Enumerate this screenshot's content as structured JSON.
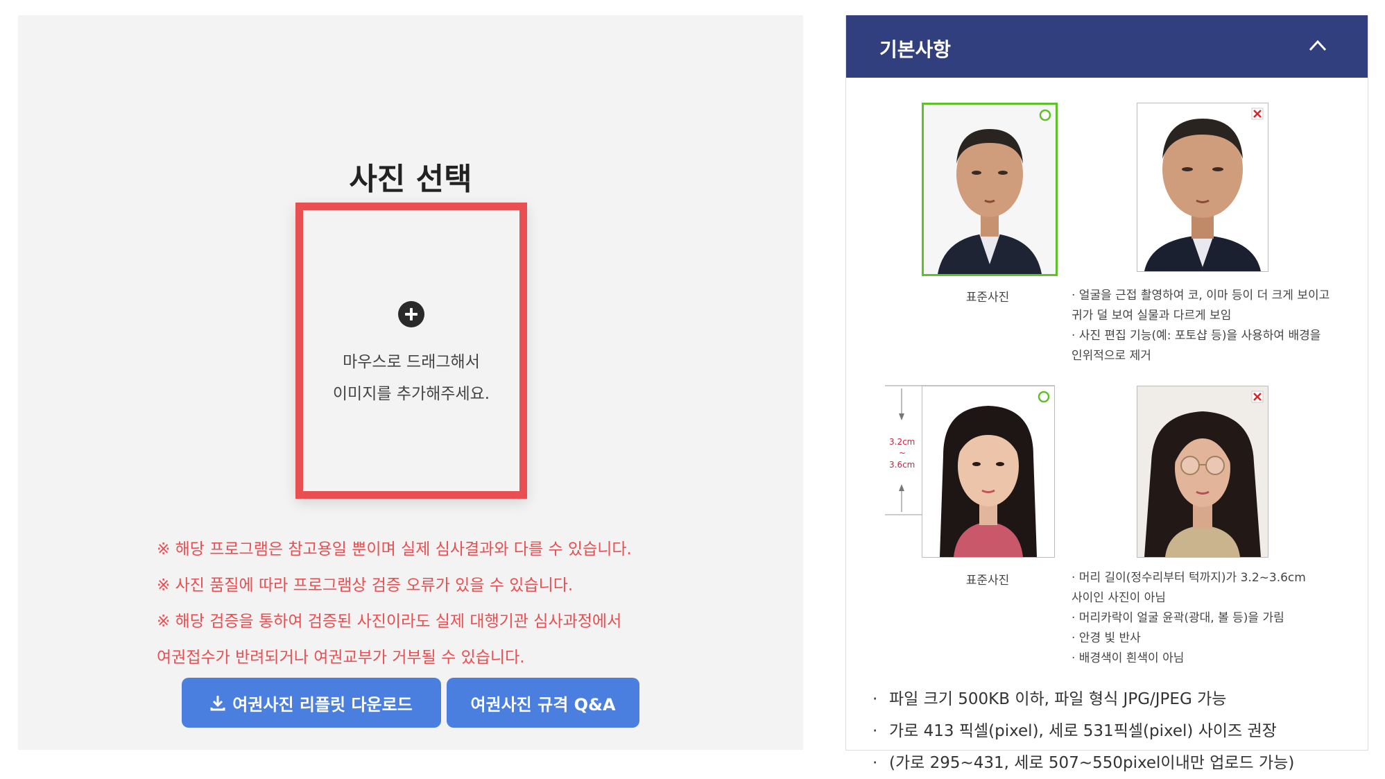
{
  "left": {
    "title": "사진 선택",
    "dropzone": {
      "line1": "마우스로 드래그해서",
      "line2": "이미지를 추가해주세요."
    },
    "notices": [
      "※ 해당 프로그램은 참고용일 뿐이며 실제 심사결과와 다를 수 있습니다.",
      "※ 사진 품질에 따라 프로그램상 검증 오류가 있을 수 있습니다.",
      "※ 해당 검증을 통하여 검증된 사진이라도 실제 대행기관 심사과정에서",
      "여권접수가 반려되거나 여권교부가 거부될 수 있습니다."
    ],
    "buttons": {
      "leaflet": "여권사진 리플릿 다운로드",
      "qa": "여권사진 규격 Q&A"
    }
  },
  "right": {
    "header": "기본사항",
    "examples": {
      "standard_caption_1": "표준사진",
      "bad1": [
        "· 얼굴을 근접 촬영하여 코, 이마 등이 더 크게 보이고",
        "귀가 덜 보여 실물과 다르게 보임",
        "· 사진 편집 기능(예: 포토샵 등)을 사용하여 배경을",
        "인위적으로 제거"
      ],
      "standard_caption_2": "표준사진",
      "ruler_top": "3.2cm",
      "ruler_mid": "~",
      "ruler_bottom": "3.6cm",
      "bad2": [
        "· 머리 길이(정수리부터 턱까지)가 3.2~3.6cm",
        "사이인 사진이 아님",
        "· 머리카락이 얼굴 윤곽(광대, 볼 등)을 가림",
        "· 안경 빛 반사",
        "· 배경색이 흰색이 아님"
      ]
    },
    "file_rules": [
      "파일 크기 500KB 이하, 파일 형식 JPG/JPEG 가능",
      "가로 413 픽셀(pixel), 세로 531픽셀(pixel) 사이즈 권장",
      "(가로 295~431, 세로 507~550pixel이내만 업로드 가능)"
    ],
    "bullet": "·"
  },
  "colors": {
    "accent_blue": "#4a7fe0",
    "header_navy": "#323f7f",
    "notice_red": "#e94e51",
    "ok_green": "#5ec12a",
    "bad_red": "#d6262c"
  }
}
